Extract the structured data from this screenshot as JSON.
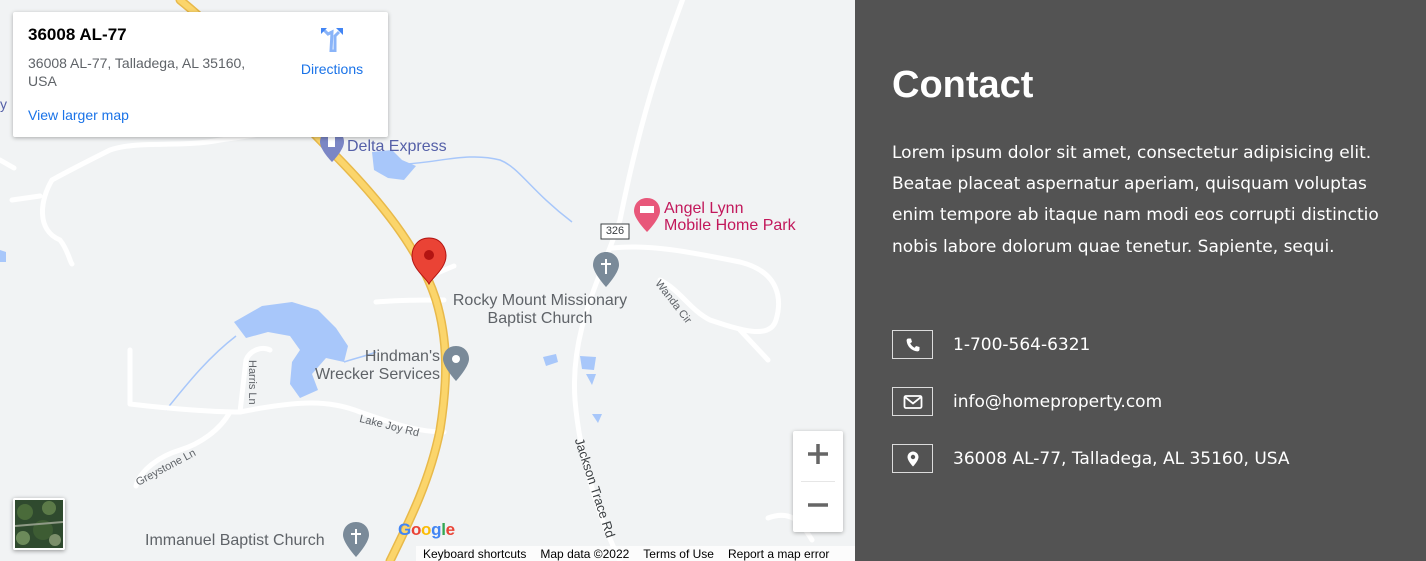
{
  "map": {
    "info_card": {
      "title": "36008 AL-77",
      "address": "36008 AL-77, Talladega, AL 35160, USA",
      "directions_label": "Directions",
      "view_larger_map": "View larger map"
    },
    "labels": {
      "delta_express": "Delta Express",
      "angel_lynn_1": "Angel Lynn",
      "angel_lynn_2": "Mobile Home Park",
      "route_shield": "326",
      "wanda_cir": "Wanda Cir",
      "rocky_mount_1": "Rocky Mount Missionary",
      "rocky_mount_2": "Baptist Church",
      "hindmans_1": "Hindman's",
      "hindmans_2": "Wrecker Services",
      "harris_ln": "Harris Ln",
      "lake_joy_rd": "Lake Joy Rd",
      "greystone_ln": "Greystone Ln",
      "jackson_trace_rd": "Jackson Trace Rd",
      "immanuel": "Immanuel Baptist Church"
    },
    "google_logo": [
      "G",
      "o",
      "o",
      "g",
      "l",
      "e"
    ],
    "attribution": {
      "keyboard": "Keyboard shortcuts",
      "map_data": "Map data ©2022",
      "terms": "Terms of Use",
      "report": "Report a map error"
    },
    "icons": {
      "directions": "directions-icon",
      "marker": "map-marker-icon",
      "zoom_in": "plus-icon",
      "zoom_out": "minus-icon"
    },
    "colors": {
      "water": "#a8c7fa",
      "highway": "#fbd56b",
      "pink_poi": "#c2185b",
      "link": "#1a73e8"
    }
  },
  "contact": {
    "title": "Contact",
    "description": "Lorem ipsum dolor sit amet, consectetur adipisicing elit. Beatae placeat aspernatur aperiam, quisquam voluptas enim tempore ab itaque nam modi eos corrupti distinctio nobis labore dolorum quae tenetur. Sapiente, sequi.",
    "phone": "1-700-564-6321",
    "email": "info@homeproperty.com",
    "address": "36008 AL-77, Talladega, AL 35160, USA",
    "icons": [
      "phone-icon",
      "envelope-icon",
      "map-pin-icon"
    ],
    "background_color": "#535353"
  }
}
